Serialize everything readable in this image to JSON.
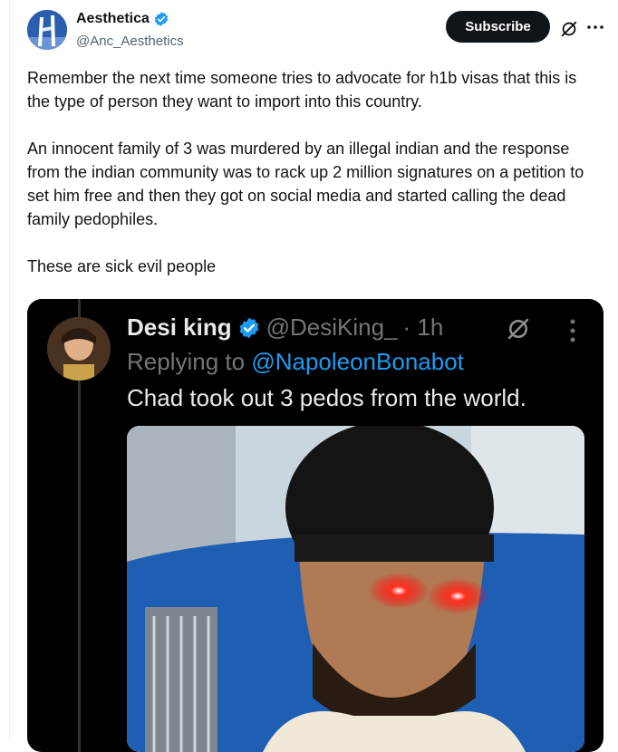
{
  "post": {
    "author_name": "Aesthetica",
    "author_handle": "@Anc_Aesthetics",
    "subscribe_label": "Subscribe",
    "more_label": "···",
    "paragraphs": [
      "Remember the next time someone tries to advocate for h1b visas that this is the type of person they want to import into this country.",
      "An innocent family of 3 was murdered by an illegal indian and the response from the indian community was to rack up 2 million signatures on a petition to set him free and then they got on social media and started calling the dead family pedophiles.",
      "These are sick evil people"
    ]
  },
  "embedded": {
    "name": "Desi king",
    "handle": "@DesiKing_",
    "time": "· 1h",
    "reply_prefix": "Replying to ",
    "reply_mention": "@NapoleonBonabot",
    "text": "Chad took out 3 pedos from the world."
  },
  "icons": {
    "verified": "verified-badge-icon",
    "grok": "grok-icon",
    "more": "more-icon"
  },
  "colors": {
    "verified": "#1d9bf0",
    "subscribe_bg": "#0f1419",
    "mention": "#1d9bf0"
  }
}
